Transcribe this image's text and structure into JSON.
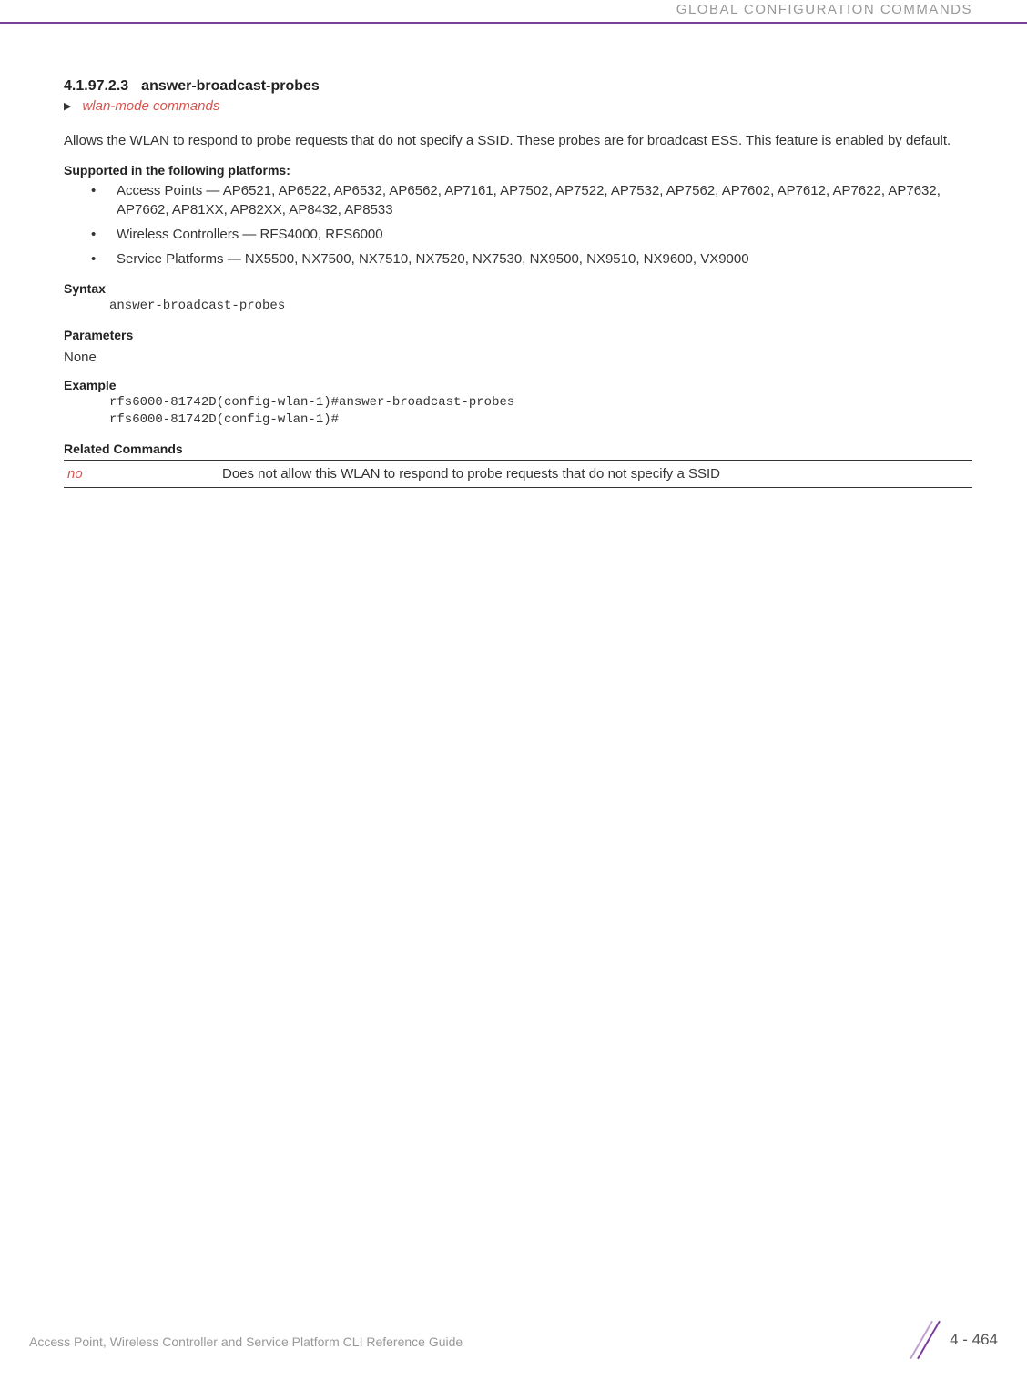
{
  "header": {
    "title": "GLOBAL CONFIGURATION COMMANDS"
  },
  "section": {
    "number": "4.1.97.2.3",
    "title": "answer-broadcast-probes",
    "link_text": "wlan-mode commands",
    "description": "Allows the WLAN to respond to probe requests that do not specify a SSID. These probes are for broadcast ESS. This feature is enabled by default."
  },
  "platforms": {
    "heading": "Supported in the following platforms:",
    "items": [
      "Access Points — AP6521, AP6522, AP6532, AP6562, AP7161, AP7502, AP7522, AP7532, AP7562, AP7602, AP7612, AP7622, AP7632, AP7662, AP81XX, AP82XX, AP8432, AP8533",
      "Wireless Controllers — RFS4000, RFS6000",
      "Service Platforms — NX5500, NX7500, NX7510, NX7520, NX7530, NX9500, NX9510, NX9600, VX9000"
    ]
  },
  "syntax": {
    "heading": "Syntax",
    "code": "answer-broadcast-probes"
  },
  "parameters": {
    "heading": "Parameters",
    "value": "None"
  },
  "example": {
    "heading": "Example",
    "code": "rfs6000-81742D(config-wlan-1)#answer-broadcast-probes\nrfs6000-81742D(config-wlan-1)#"
  },
  "related": {
    "heading": "Related Commands",
    "rows": [
      {
        "cmd": "no",
        "desc": "Does not allow this WLAN to respond to probe requests that do not specify a SSID"
      }
    ]
  },
  "footer": {
    "title": "Access Point, Wireless Controller and Service Platform CLI Reference Guide",
    "page": "4 - 464"
  }
}
